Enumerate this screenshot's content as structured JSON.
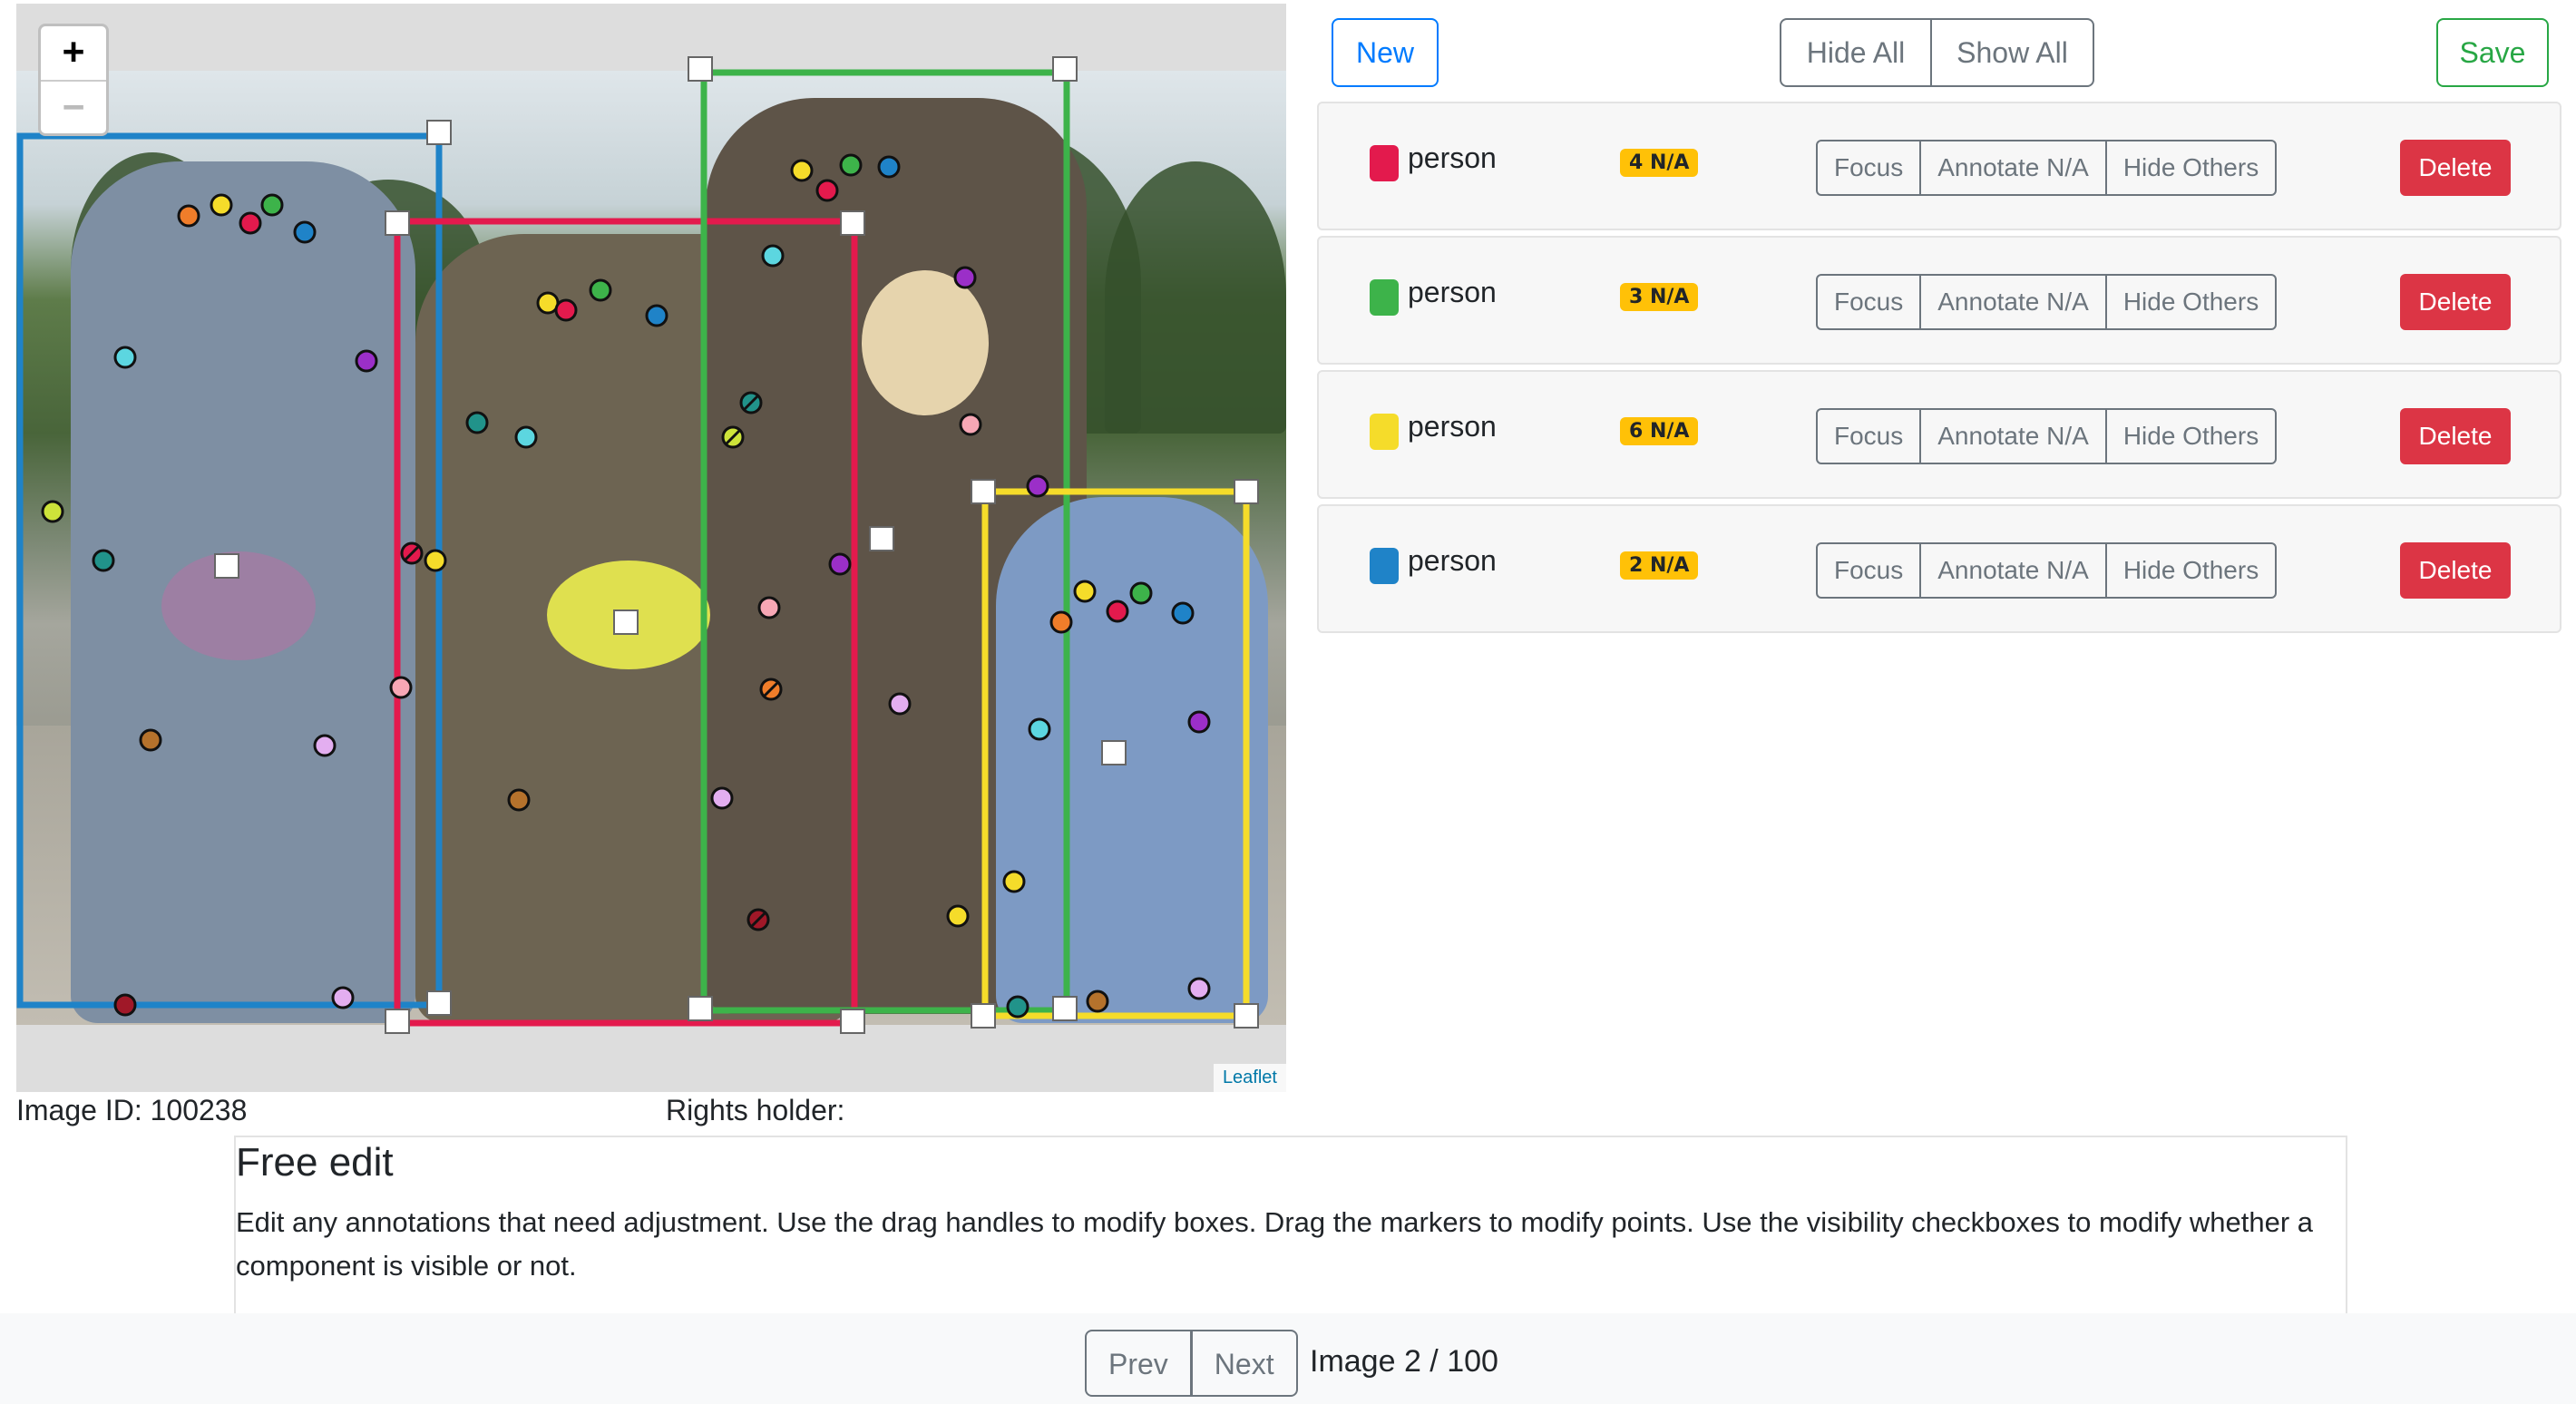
{
  "toolbar": {
    "new_label": "New",
    "hide_all_label": "Hide All",
    "show_all_label": "Show All",
    "save_label": "Save"
  },
  "map": {
    "zoom_in": "+",
    "zoom_out": "−",
    "attribution": "Leaflet"
  },
  "image_meta": {
    "image_id": "Image ID: 100238",
    "rights_holder": "Rights holder:"
  },
  "colors": {
    "red": "#e31a4d",
    "green": "#3db34a",
    "yellow": "#f5dc2a",
    "blue": "#1f83c8"
  },
  "annotations": [
    {
      "label": "person",
      "color": "#e31a4d",
      "badge": "4 N/A",
      "focus": "Focus",
      "annotate": "Annotate N/A",
      "hide_others": "Hide Others",
      "delete": "Delete"
    },
    {
      "label": "person",
      "color": "#3db34a",
      "badge": "3 N/A",
      "focus": "Focus",
      "annotate": "Annotate N/A",
      "hide_others": "Hide Others",
      "delete": "Delete"
    },
    {
      "label": "person",
      "color": "#f5dc2a",
      "badge": "6 N/A",
      "focus": "Focus",
      "annotate": "Annotate N/A",
      "hide_others": "Hide Others",
      "delete": "Delete"
    },
    {
      "label": "person",
      "color": "#1f83c8",
      "badge": "2 N/A",
      "focus": "Focus",
      "annotate": "Annotate N/A",
      "hide_others": "Hide Others",
      "delete": "Delete"
    }
  ],
  "instructions": {
    "title": "Free edit",
    "body": "Edit any annotations that need adjustment. Use the drag handles to modify boxes. Drag the markers to modify points. Use the visibility checkboxes to modify whether a component is visible or not."
  },
  "pagination": {
    "prev": "Prev",
    "next": "Next",
    "page_info": "Image 2 / 100"
  }
}
